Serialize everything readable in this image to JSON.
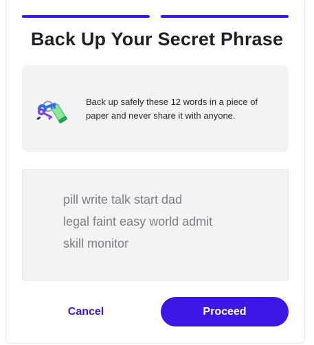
{
  "header": {
    "title": "Back Up Your Secret Phrase",
    "progress_steps": 2,
    "active_steps": 2
  },
  "info": {
    "illustration_icon": "keys-icon",
    "text": "Back up safely these 12 words in a piece of paper and never share it with anyone."
  },
  "phrase": {
    "lines": [
      "pill write talk start dad",
      "legal faint easy world admit",
      "skill monitor"
    ]
  },
  "actions": {
    "cancel_label": "Cancel",
    "proceed_label": "Proceed"
  },
  "colors": {
    "accent": "#3d16e6",
    "card_background": "#f3f3f6",
    "title_text": "#1f2128",
    "phrase_text": "#7a7d86"
  }
}
